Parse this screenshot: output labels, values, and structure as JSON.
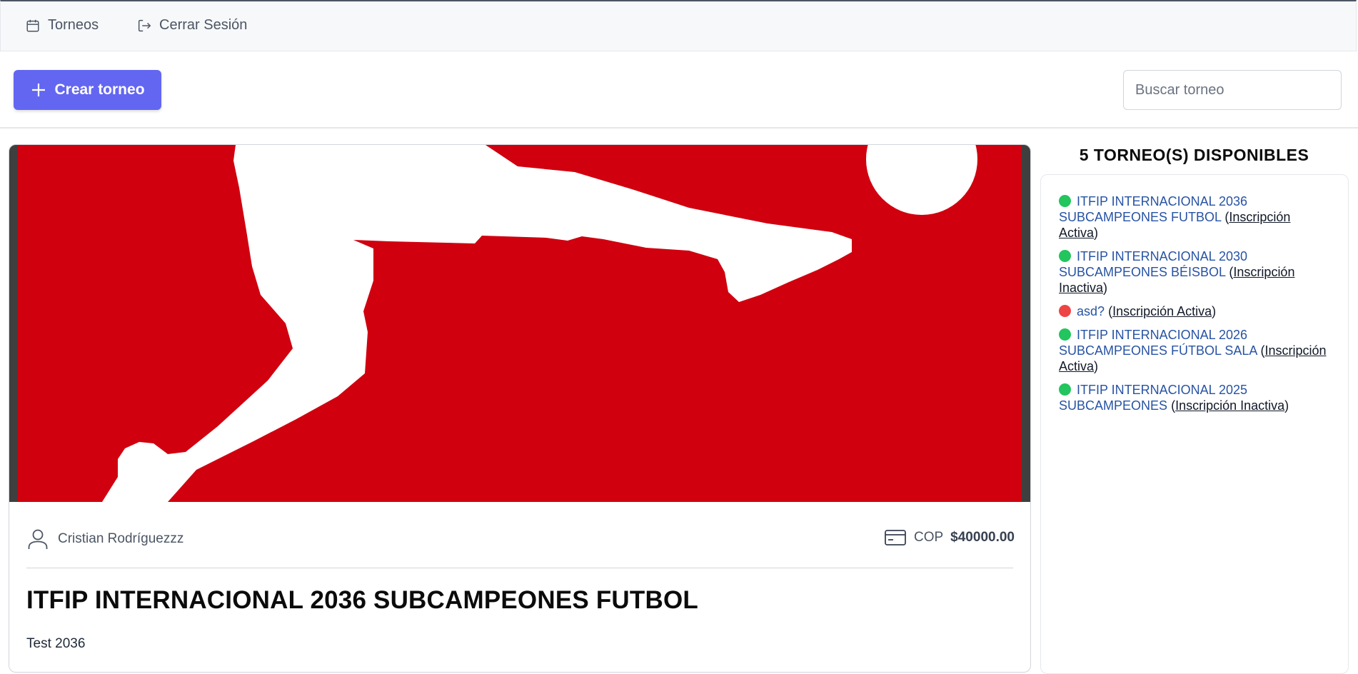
{
  "nav": {
    "tournaments_label": "Torneos",
    "logout_label": "Cerrar Sesión"
  },
  "toolbar": {
    "create_label": "Crear torneo",
    "search_placeholder": "Buscar torneo"
  },
  "card": {
    "author": "Cristian Rodríguezzz",
    "currency": "COP",
    "price": "$40000.00",
    "title": "ITFIP INTERNACIONAL 2036 SUBCAMPEONES FUTBOL",
    "description": "Test 2036",
    "banner_color": "#d0000f"
  },
  "sidebar": {
    "heading": "5 TORNEO(S) DISPONIBLES",
    "items": [
      {
        "name": "ITFIP INTERNACIONAL 2036 SUBCAMPEONES FUTBOL",
        "status": "Inscripción Activa",
        "dot_color": "#22c55e"
      },
      {
        "name": "ITFIP INTERNACIONAL 2030 SUBCAMPEONES BÉISBOL",
        "status": "Inscripción Inactiva",
        "dot_color": "#22c55e"
      },
      {
        "name": "asd?",
        "status": "Inscripción Activa",
        "dot_color": "#ef4444"
      },
      {
        "name": "ITFIP INTERNACIONAL 2026 SUBCAMPEONES FÚTBOL SALA",
        "status": "Inscripción Activa",
        "dot_color": "#22c55e"
      },
      {
        "name": "ITFIP INTERNACIONAL 2025 SUBCAMPEONES",
        "status": "Inscripción Inactiva",
        "dot_color": "#22c55e"
      }
    ]
  },
  "colors": {
    "accent": "#6366f1",
    "link": "#2753a4"
  }
}
